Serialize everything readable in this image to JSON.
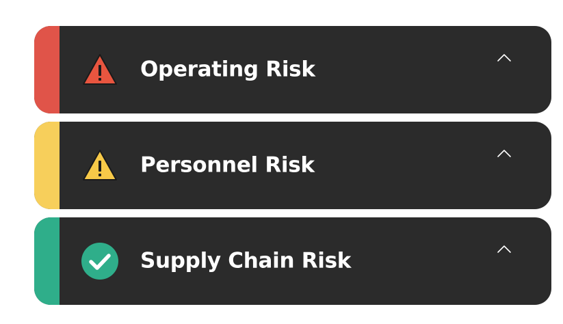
{
  "risk_cards": [
    {
      "title": "Operating Risk",
      "status": "warning-high",
      "accent_color": "#e05449",
      "icon": "warning-triangle-icon",
      "icon_color": "#e8553f",
      "expanded": true
    },
    {
      "title": "Personnel Risk",
      "status": "warning-medium",
      "accent_color": "#f7cf5b",
      "icon": "warning-triangle-icon",
      "icon_color": "#f7c948",
      "expanded": true
    },
    {
      "title": "Supply Chain Risk",
      "status": "ok",
      "accent_color": "#2fae8a",
      "icon": "check-circle-icon",
      "icon_color": "#2fae8a",
      "expanded": true
    }
  ],
  "colors": {
    "card_background": "#2b2b2b",
    "title_text": "#ffffff",
    "page_background": "#ffffff"
  }
}
